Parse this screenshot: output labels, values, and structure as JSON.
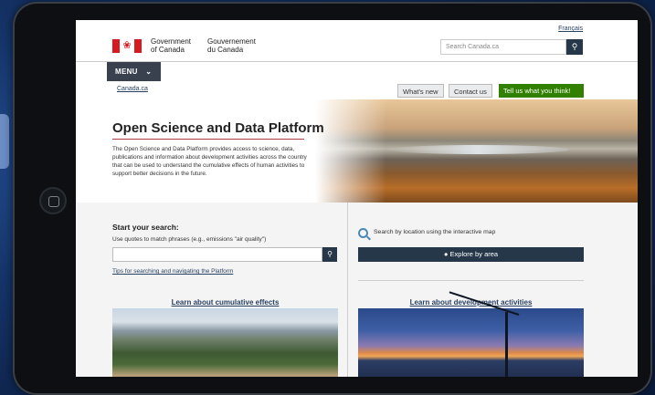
{
  "header": {
    "language_link": "Français",
    "gov_en_line1": "Government",
    "gov_en_line2": "of Canada",
    "gov_fr_line1": "Gouvernement",
    "gov_fr_line2": "du Canada",
    "search_placeholder": "Search Canada.ca",
    "menu_label": "MENU"
  },
  "breadcrumb": "Canada.ca",
  "actions": {
    "whats_new": "What's new",
    "contact_us": "Contact us",
    "feedback": "Tell us what you think!"
  },
  "hero": {
    "title": "Open Science and Data Platform",
    "description": "The Open Science and Data Platform provides access to science, data, publications and information about development activities across the country that can be used to understand the cumulative effects of human activities to support better decisions in the future."
  },
  "search": {
    "title": "Start your search:",
    "hint": "Use quotes to match phrases (e.g., emissions \"air quality\")",
    "tips_link": "Tips for searching and navigating the Platform",
    "map_text": "Search by location using the interactive map",
    "explore_button": "Explore by area"
  },
  "cards": {
    "cumulative": "Learn about cumulative effects",
    "development": "Learn about development activities"
  },
  "colors": {
    "nav_dark": "#26374a",
    "feedback_green": "#318000",
    "flag_red": "#d71920"
  }
}
